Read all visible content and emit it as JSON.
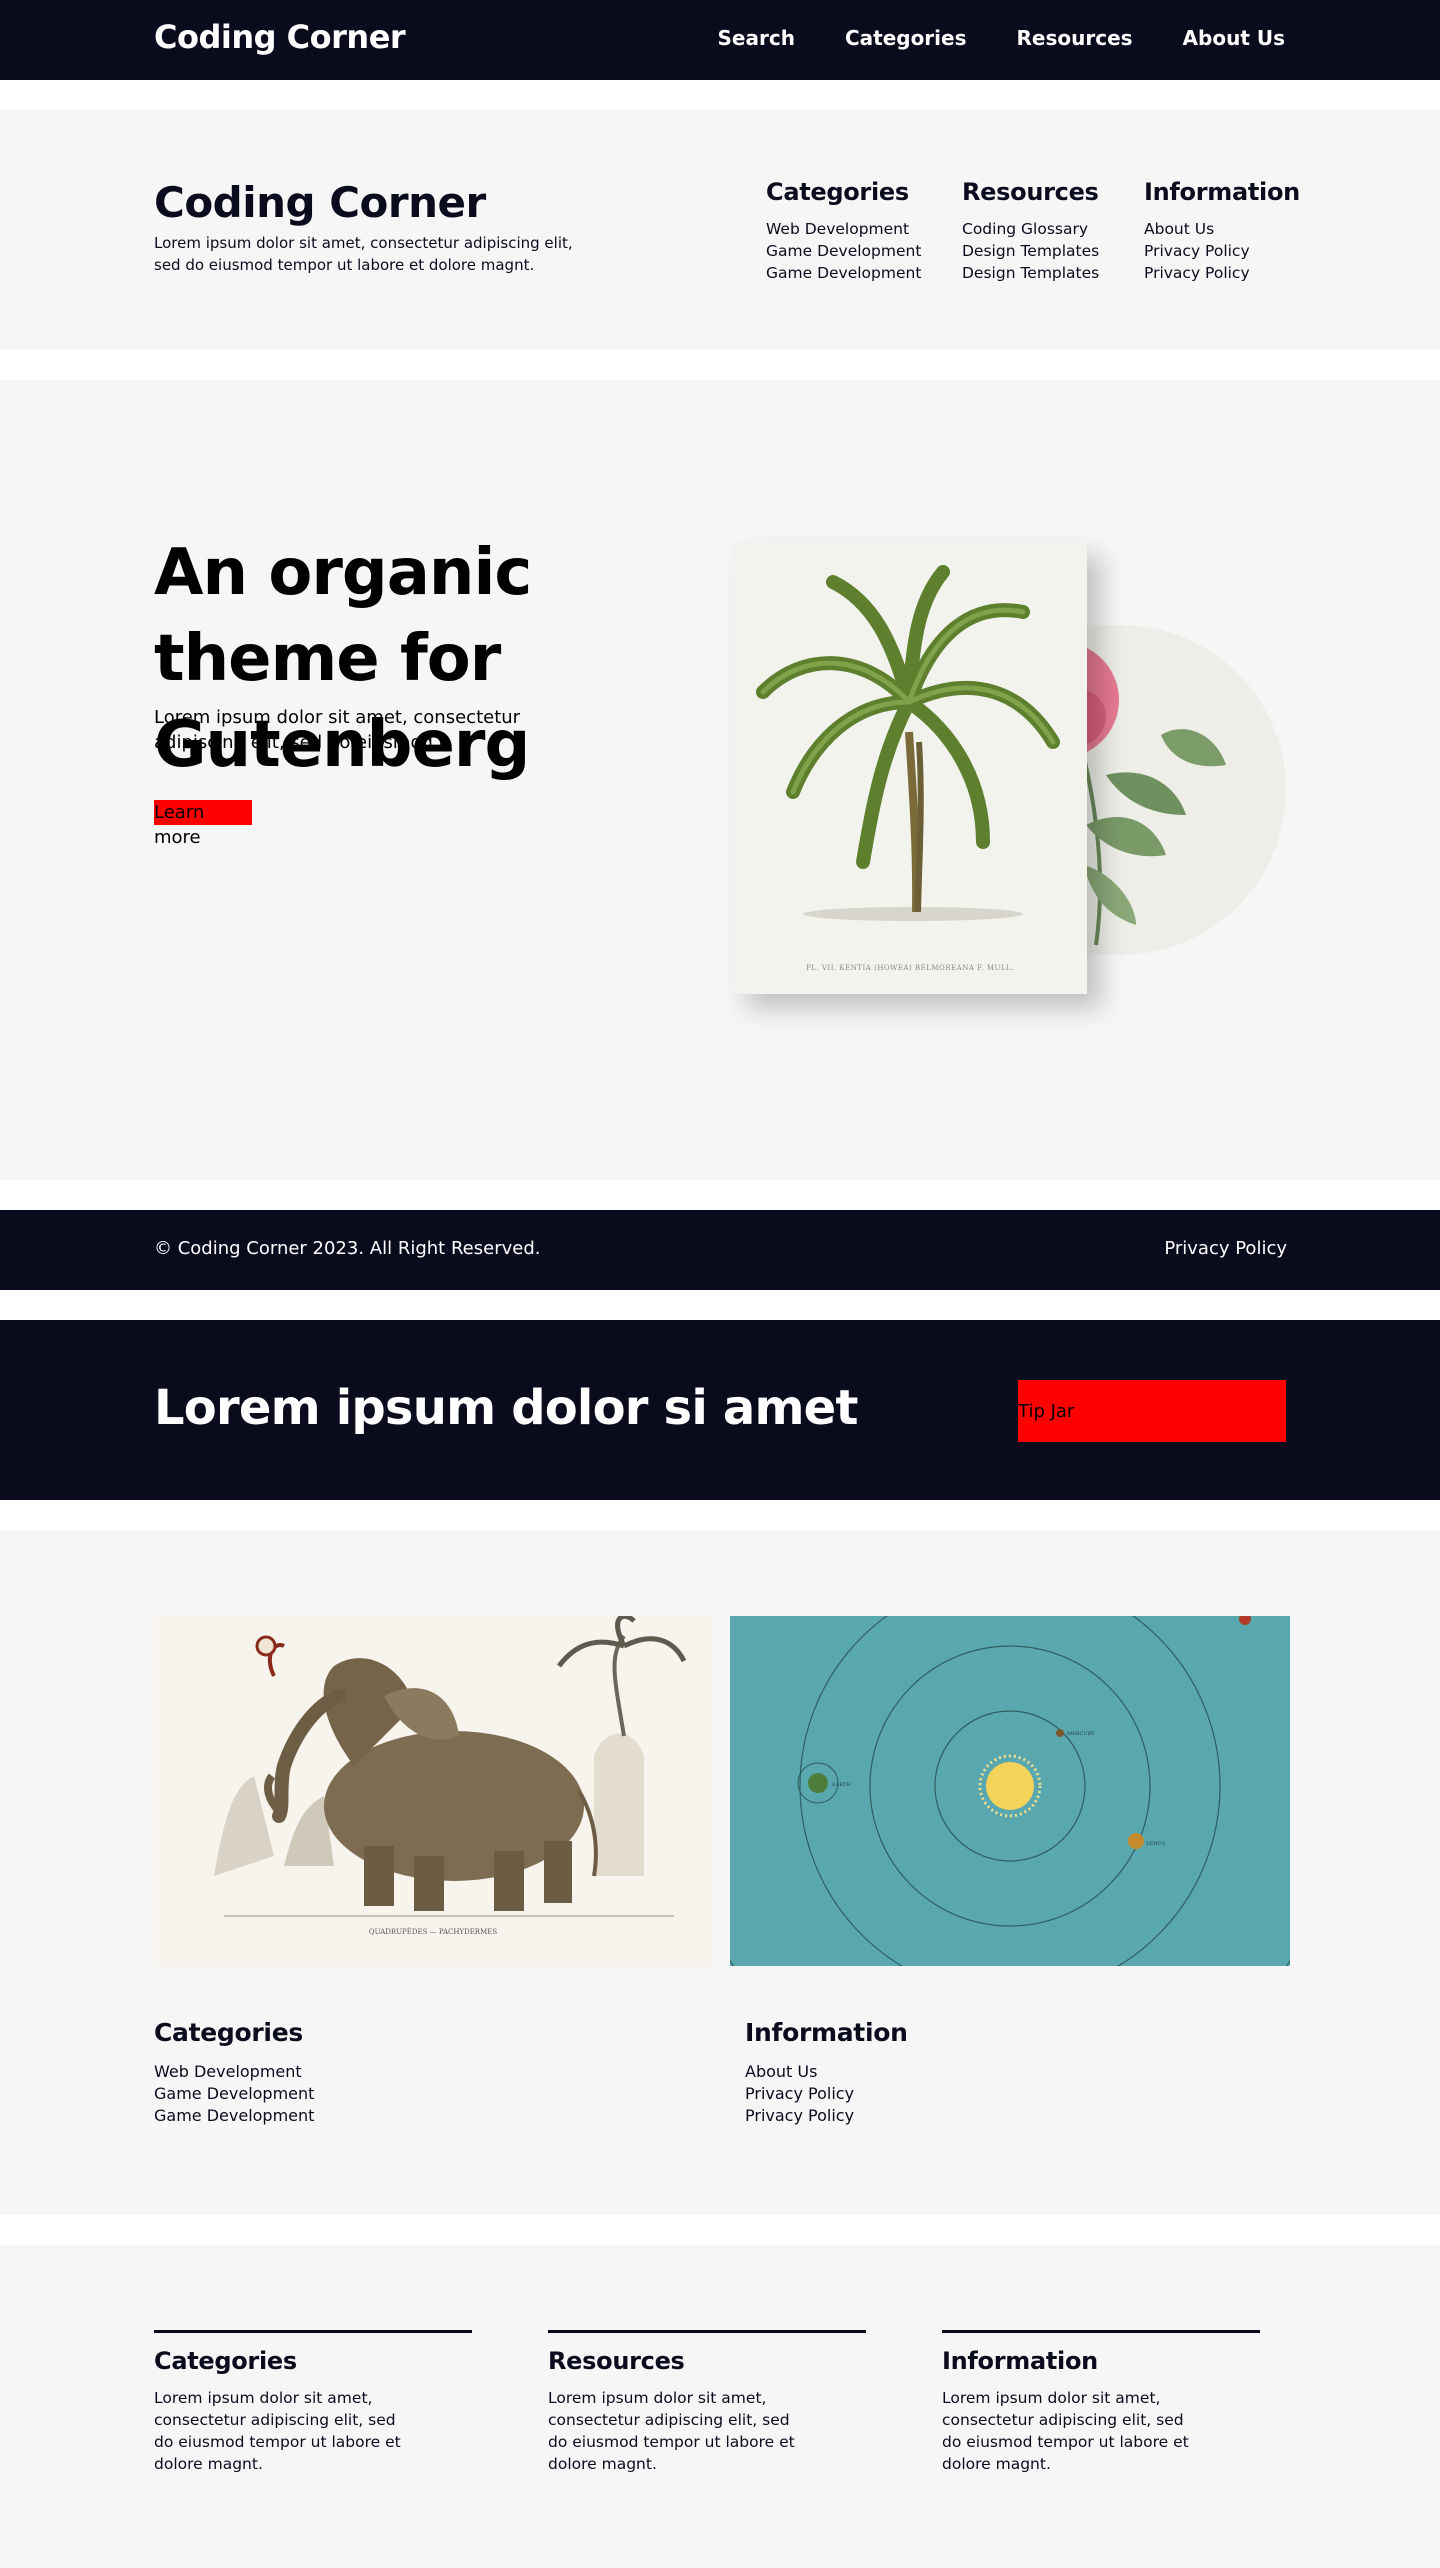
{
  "header": {
    "brand": "Coding Corner",
    "nav": [
      "Search",
      "Categories",
      "Resources",
      "About Us"
    ]
  },
  "footer_top": {
    "title": "Coding Corner",
    "description": "Lorem ipsum dolor sit amet, consectetur adipiscing elit, sed do eiusmod tempor ut labore et dolore magnt.",
    "columns": [
      {
        "heading": "Categories",
        "items": [
          "Web Development",
          "Game Development",
          "Game Development"
        ]
      },
      {
        "heading": "Resources",
        "items": [
          "Coding Glossary",
          "Design Templates",
          "Design Templates"
        ]
      },
      {
        "heading": "Information",
        "items": [
          "About Us",
          "Privacy Policy",
          "Privacy Policy"
        ]
      }
    ]
  },
  "hero": {
    "heading": "An organic theme for Gutenberg",
    "lead": "Lorem ipsum dolor sit amet, consectetur adipiscing elit, sed do eiusmod.",
    "button": "Learn more",
    "card_caption": "PL. VII. KENTIA (HOWEA) BELMOREANA F. MULL."
  },
  "footer_bar": {
    "copyright": "© Coding Corner 2023. All Right Reserved.",
    "privacy": "Privacy Policy"
  },
  "cta": {
    "heading": "Lorem ipsum dolor si amet",
    "button": "Tip Jar"
  },
  "gallery": {
    "columns": [
      {
        "heading": "Categories",
        "items": [
          "Web Development",
          "Game Development",
          "Game Development"
        ]
      },
      {
        "heading": "Information",
        "items": [
          "About Us",
          "Privacy Policy",
          "Privacy Policy"
        ]
      }
    ]
  },
  "bottom": {
    "columns": [
      {
        "heading": "Categories",
        "text": "Lorem ipsum dolor sit amet, consectetur adipiscing elit, sed do eiusmod tempor ut labore et dolore magnt."
      },
      {
        "heading": "Resources",
        "text": "Lorem ipsum dolor sit amet, consectetur adipiscing elit, sed do eiusmod tempor ut labore et dolore magnt."
      },
      {
        "heading": "Information",
        "text": "Lorem ipsum dolor sit amet, consectetur adipiscing elit, sed do eiusmod tempor ut labore et dolore magnt."
      }
    ]
  },
  "colors": {
    "navy": "#0b0b1e",
    "section_bg": "#f6f6f6",
    "button_red": "#ff0000",
    "teal": "#5ba9b0"
  }
}
